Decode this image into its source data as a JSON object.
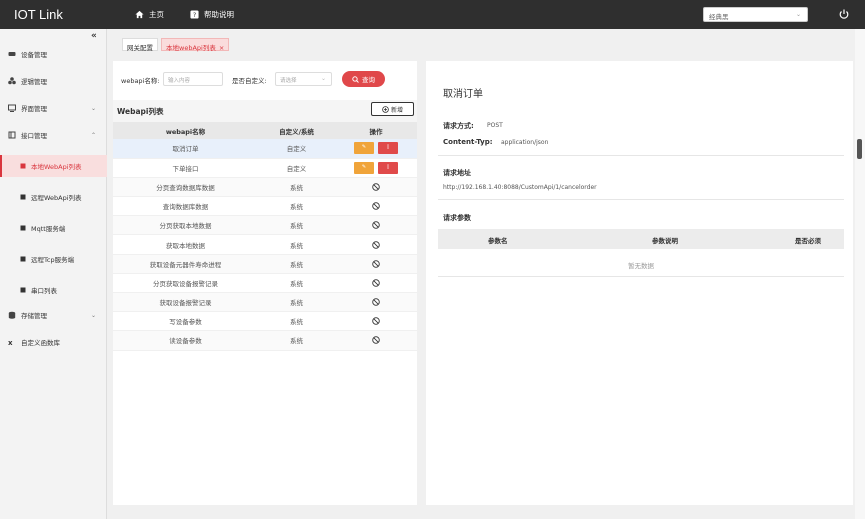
{
  "app": {
    "title": "IOT Link"
  },
  "topnav": [
    {
      "label": "主页",
      "icon": "home-icon"
    },
    {
      "label": "帮助说明",
      "icon": "help-icon"
    }
  ],
  "theme_select": {
    "value": "经典黑"
  },
  "sidebar": {
    "items": [
      {
        "label": "设备管理",
        "icon": "device-icon"
      },
      {
        "label": "逻辑管理",
        "icon": "logic-icon"
      },
      {
        "label": "界面管理",
        "icon": "monitor-icon"
      },
      {
        "label": "接口管理",
        "icon": "interface-icon"
      },
      {
        "label": "本地WebApi列表",
        "icon": "dot-icon"
      },
      {
        "label": "远程WebApi列表",
        "icon": "dot-icon"
      },
      {
        "label": "Mqtt服务端",
        "icon": "dot-icon"
      },
      {
        "label": "远程Tcp服务端",
        "icon": "dot-icon"
      },
      {
        "label": "串口列表",
        "icon": "dot-icon"
      },
      {
        "label": "存储管理",
        "icon": "storage-icon"
      },
      {
        "label": "自定义函数库",
        "icon": "function-icon"
      }
    ]
  },
  "tabs": [
    {
      "label": "网关配置"
    },
    {
      "label": "本地webApi列表",
      "close": "×"
    }
  ],
  "filter": {
    "name_label": "webapi名称:",
    "name_placeholder": "输入内容",
    "custom_label": "是否自定义:",
    "custom_placeholder": "请选择",
    "query_label": "查询"
  },
  "list": {
    "title": "Webapi列表",
    "add_label": "新增",
    "columns": [
      "webapi名称",
      "自定义/系统",
      "操作"
    ],
    "rows": [
      {
        "name": "取消订单",
        "type": "自定义"
      },
      {
        "name": "下单接口",
        "type": "自定义"
      },
      {
        "name": "分页查询数据库数据",
        "type": "系统"
      },
      {
        "name": "查询数据库数据",
        "type": "系统"
      },
      {
        "name": "分页获取本地数据",
        "type": "系统"
      },
      {
        "name": "获取本地数据",
        "type": "系统"
      },
      {
        "name": "获取设备元器件寿命进程",
        "type": "系统"
      },
      {
        "name": "分页获取设备报警记录",
        "type": "系统"
      },
      {
        "name": "获取设备报警记录",
        "type": "系统"
      },
      {
        "name": "写设备参数",
        "type": "系统"
      },
      {
        "name": "读设备参数",
        "type": "系统"
      }
    ]
  },
  "detail": {
    "title": "取消订单",
    "method_label": "请求方式:",
    "method_value": "POST",
    "ctype_label": "Content-Typ:",
    "ctype_value": "application/json",
    "url_label": "请求地址",
    "url_value": "http://192.168.1.40:8088/CustomApi/1/cancelorder",
    "params_label": "请求参数",
    "params_columns": [
      "参数名",
      "参数说明",
      "是否必须"
    ],
    "empty_text": "暂无数据"
  },
  "colors": {
    "accent": "#d9363e",
    "edit": "#f0a43a",
    "delete": "#e04a4a",
    "topbar": "#2f2f2f"
  }
}
